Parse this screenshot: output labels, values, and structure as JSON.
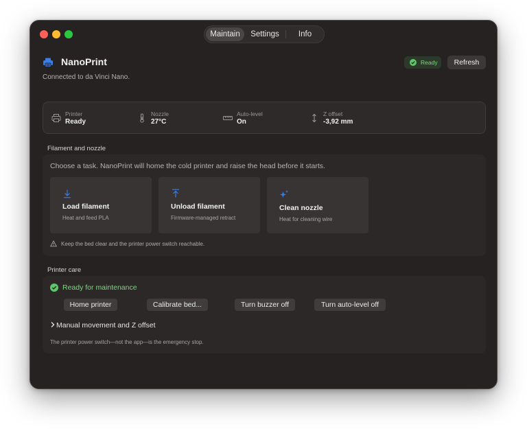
{
  "tabs": [
    {
      "label": "Maintain",
      "active": true
    },
    {
      "label": "Settings",
      "active": false
    },
    {
      "label": "Info",
      "active": false
    }
  ],
  "header": {
    "app_name": "NanoPrint",
    "subtitle": "Connected to da Vinci Nano.",
    "status_badge": "Ready",
    "refresh_label": "Refresh",
    "app_icon": "printer-icon"
  },
  "status": [
    {
      "label": "Printer",
      "value": "Ready",
      "icon": "printer-icon"
    },
    {
      "label": "Nozzle",
      "value": "27°C",
      "icon": "thermometer-icon"
    },
    {
      "label": "Auto-level",
      "value": "On",
      "icon": "ruler-icon"
    },
    {
      "label": "Z offset",
      "value": "-3,92 mm",
      "icon": "vertical-arrows-icon"
    }
  ],
  "filament": {
    "section_title": "Filament and nozzle",
    "intro": "Choose a task. NanoPrint will home the cold printer and raise the head before it starts.",
    "tasks": [
      {
        "title": "Load filament",
        "description": "Heat and feed PLA",
        "icon": "arrow-down-icon"
      },
      {
        "title": "Unload filament",
        "description": "Firmware-managed retract",
        "icon": "arrow-up-icon"
      },
      {
        "title": "Clean nozzle",
        "description": "Heat for cleaning wire",
        "icon": "sparkles-icon"
      }
    ],
    "warning": "Keep the bed clear and the printer power switch reachable."
  },
  "care": {
    "section_title": "Printer care",
    "status_text": "Ready for maintenance",
    "buttons": [
      {
        "label": "Home printer"
      },
      {
        "label": "Calibrate bed..."
      },
      {
        "label": "Turn buzzer off"
      },
      {
        "label": "Turn auto-level off"
      }
    ],
    "manual_label": "Manual movement and Z offset",
    "footnote": "The printer power switch—not the app—is the emergency stop."
  },
  "colors": {
    "window_bg": "#252221",
    "card_bg": "#2b2827",
    "accent_blue": "#3b7fe6",
    "status_green": "#5fc76a"
  }
}
